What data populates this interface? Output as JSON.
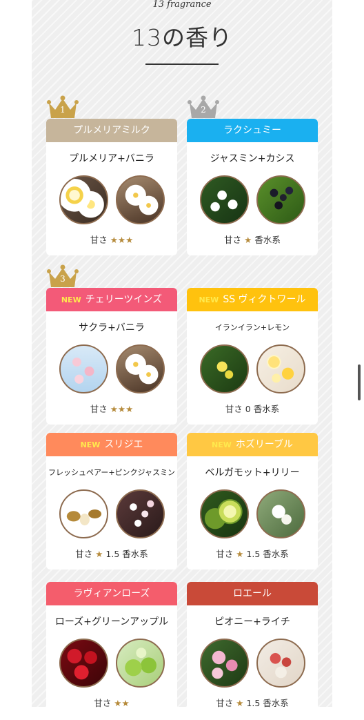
{
  "header": {
    "subtitle": "13 fragrance",
    "title": "13の香り"
  },
  "crowns": [
    {
      "rank": "1",
      "color": "#c9a24a"
    },
    {
      "rank": "2",
      "color": "#a8a8a8"
    },
    {
      "rank": "3",
      "color": "#c9a24a"
    }
  ],
  "cards": [
    {
      "name": "プルメリアミルク",
      "new": "",
      "head_color": "#c6b59b",
      "sub": "プルメリア+バニラ",
      "sweet_label": "甘さ",
      "stars": "★★★",
      "suffix": "",
      "images": [
        "plumeria-image",
        "vanilla-jasmine-image"
      ]
    },
    {
      "name": "ラクシュミー",
      "new": "",
      "head_color": "#1ab0f0",
      "sub": "ジャスミン+カシス",
      "sweet_label": "甘さ",
      "stars": "★",
      "suffix": "香水系",
      "images": [
        "jasmine-image",
        "cassis-image"
      ]
    },
    {
      "name": "チェリーツインズ",
      "new": "NEW",
      "head_color": "#f35a78",
      "sub": "サクラ+バニラ",
      "sweet_label": "甘さ",
      "stars": "★★★",
      "suffix": "",
      "images": [
        "sakura-image",
        "vanilla-jasmine-image"
      ]
    },
    {
      "name": "SS ヴィクトワール",
      "new": "NEW",
      "head_color": "#ffc20e",
      "sub": "イランイラン+レモン",
      "sweet_label": "甘さ",
      "stars": "",
      "suffix": "0 香水系",
      "images": [
        "ylang-ylang-image",
        "lemon-image"
      ]
    },
    {
      "name": "スリジエ",
      "new": "NEW",
      "head_color": "#ff8a5c",
      "sub": "フレッシュペアー+ピンクジャスミン",
      "sweet_label": "甘さ",
      "stars": "★",
      "suffix": "1.5 香水系",
      "images": [
        "pear-image",
        "pink-jasmine-image"
      ]
    },
    {
      "name": "ホズリーブル",
      "new": "NEW",
      "head_color": "#ffc843",
      "sub": "ベルガモット+リリー",
      "sweet_label": "甘さ",
      "stars": "★",
      "suffix": "1.5 香水系",
      "images": [
        "bergamot-image",
        "lily-image"
      ]
    },
    {
      "name": "ラヴィアンローズ",
      "new": "",
      "head_color": "#f45d6c",
      "sub": "ローズ+グリーンアップル",
      "sweet_label": "甘さ",
      "stars": "★★",
      "suffix": "",
      "images": [
        "rose-image",
        "green-apple-image"
      ]
    },
    {
      "name": "ロエール",
      "new": "",
      "head_color": "#c94a38",
      "sub": "ピオニー+ライチ",
      "sweet_label": "甘さ",
      "stars": "★",
      "suffix": "1.5 香水系",
      "images": [
        "peony-image",
        "lychee-image"
      ]
    }
  ]
}
